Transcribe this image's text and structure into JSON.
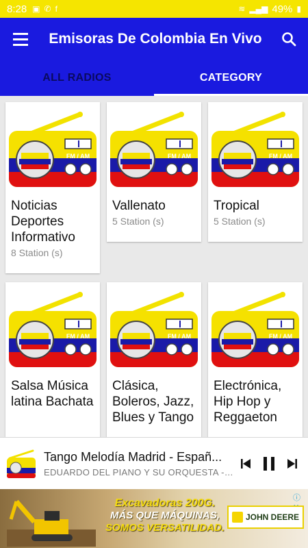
{
  "status_bar": {
    "time": "8:28",
    "battery": "49%",
    "bg_color": "#f5e500"
  },
  "app_bar": {
    "title": "Emisoras De Colombia En Vivo",
    "menu_icon": "hamburger-menu-icon",
    "search_icon": "search-icon",
    "bg_color": "#1a1adf"
  },
  "tabs": [
    {
      "label": "ALL RADIOS",
      "active": false
    },
    {
      "label": "CATEGORY",
      "active": true
    }
  ],
  "categories": [
    {
      "name": "Noticias Deportes Informativo",
      "count": "8 Station (s)"
    },
    {
      "name": "Vallenato",
      "count": "5 Station (s)"
    },
    {
      "name": "Tropical",
      "count": "5 Station (s)"
    },
    {
      "name": "Salsa Música latina Bachata",
      "count": ""
    },
    {
      "name": "Clásica, Boleros, Jazz, Blues y Tango",
      "count": ""
    },
    {
      "name": "Electrónica, Hip Hop y Reggaeton",
      "count": ""
    }
  ],
  "radio_label": "FM / AM",
  "player": {
    "title": "Tango Melodía Madrid - Españ...",
    "artist": "EDUARDO DEL PIANO Y SU ORQUESTA - L...",
    "is_playing": true
  },
  "ad": {
    "line1": "Excavadoras 200G.",
    "line2": "MÁS QUE MÁQUINAS,",
    "line3": "SOMOS VERSATILIDAD.",
    "brand": "JOHN DEERE"
  }
}
